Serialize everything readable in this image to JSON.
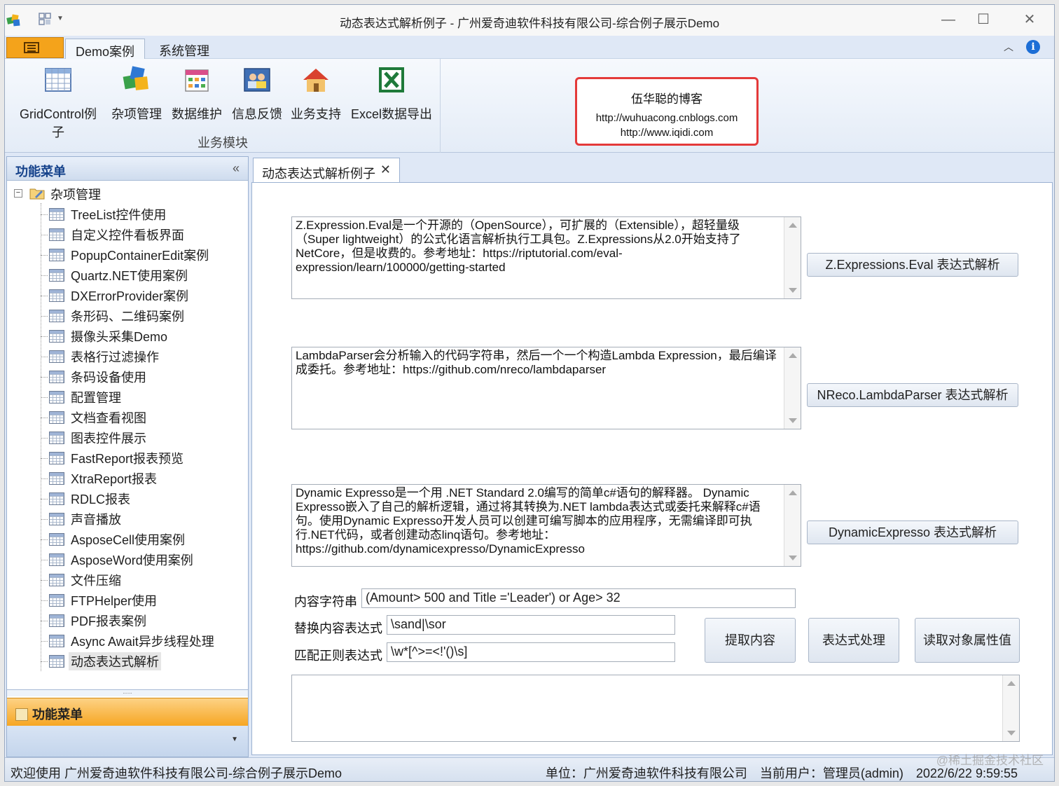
{
  "window": {
    "title": "动态表达式解析例子 - 广州爱奇迪软件科技有限公司-综合例子展示Demo"
  },
  "ribbon": {
    "tabs": [
      {
        "label": "Demo案例",
        "active": true
      },
      {
        "label": "系统管理",
        "active": false
      }
    ],
    "buttons": [
      {
        "label": "GridControl例子",
        "icon": "grid-icon"
      },
      {
        "label": "杂项管理",
        "icon": "cubes-icon"
      },
      {
        "label": "数据维护",
        "icon": "calendar-icon"
      },
      {
        "label": "信息反馈",
        "icon": "users-icon"
      },
      {
        "label": "业务支持",
        "icon": "house-icon"
      },
      {
        "label": "Excel数据导出",
        "icon": "excel-icon"
      }
    ],
    "group_label": "业务模块"
  },
  "blog": {
    "title": "伍华聪的博客",
    "url1": "http://wuhuacong.cnblogs.com",
    "url2": "http://www.iqidi.com"
  },
  "nav": {
    "header": "功能菜单",
    "root": "杂项管理",
    "items": [
      "TreeList控件使用",
      "自定义控件看板界面",
      "PopupContainerEdit案例",
      "Quartz.NET使用案例",
      "DXErrorProvider案例",
      "条形码、二维码案例",
      "摄像头采集Demo",
      "表格行过滤操作",
      "条码设备使用",
      "配置管理",
      "文档查看视图",
      "图表控件展示",
      "FastReport报表预览",
      "XtraReport报表",
      "RDLC报表",
      "声音播放",
      "AsposeCell使用案例",
      "AsposeWord使用案例",
      "文件压缩",
      "FTPHelper使用",
      "PDF报表案例",
      "Async Await异步线程处理",
      "动态表达式解析"
    ],
    "selected_index": 22,
    "bottom_label": "功能菜单"
  },
  "document": {
    "tab_label": "动态表达式解析例子",
    "memos": [
      {
        "text": "Z.Expression.Eval是一个开源的（OpenSource），可扩展的（Extensible），超轻量级（Super lightweight）的公式化语言解析执行工具包。Z.Expressions从2.0开始支持了NetCore，但是收费的。参考地址：https://riptutorial.com/eval-expression/learn/100000/getting-started",
        "button": "Z.Expressions.Eval 表达式解析"
      },
      {
        "text": "LambdaParser会分析输入的代码字符串，然后一个一个构造Lambda Expression，最后编译成委托。参考地址：https://github.com/nreco/lambdaparser",
        "button": "NReco.LambdaParser 表达式解析"
      },
      {
        "text": "Dynamic Expresso是一个用 .NET Standard 2.0编写的简单c#语句的解释器。 Dynamic Expresso嵌入了自己的解析逻辑，通过将其转换为.NET lambda表达式或委托来解释c#语句。使用Dynamic Expresso开发人员可以创建可编写脚本的应用程序，无需编译即可执行.NET代码，或者创建动态linq语句。参考地址：https://github.com/dynamicexpresso/DynamicExpresso",
        "button": "DynamicExpresso 表达式解析"
      }
    ],
    "content_label": "内容字符串",
    "content_value": "(Amount> 500 and Title ='Leader') or Age> 32",
    "replace_label": "替换内容表达式",
    "replace_value": "\\sand|\\sor",
    "regex_label": "匹配正则表达式",
    "regex_value": "\\w*[^>=<!'()\\s]",
    "extract_button": "提取内容",
    "process_button": "表达式处理",
    "read_button": "读取对象属性值",
    "output_value": ""
  },
  "statusbar": {
    "welcome": "欢迎使用 广州爱奇迪软件科技有限公司-综合例子展示Demo",
    "unit": "单位：广州爱奇迪软件科技有限公司",
    "user": "当前用户：管理员(admin)",
    "datetime": "2022/6/22 9:59:55"
  },
  "watermark": "@稀土掘金技术社区"
}
